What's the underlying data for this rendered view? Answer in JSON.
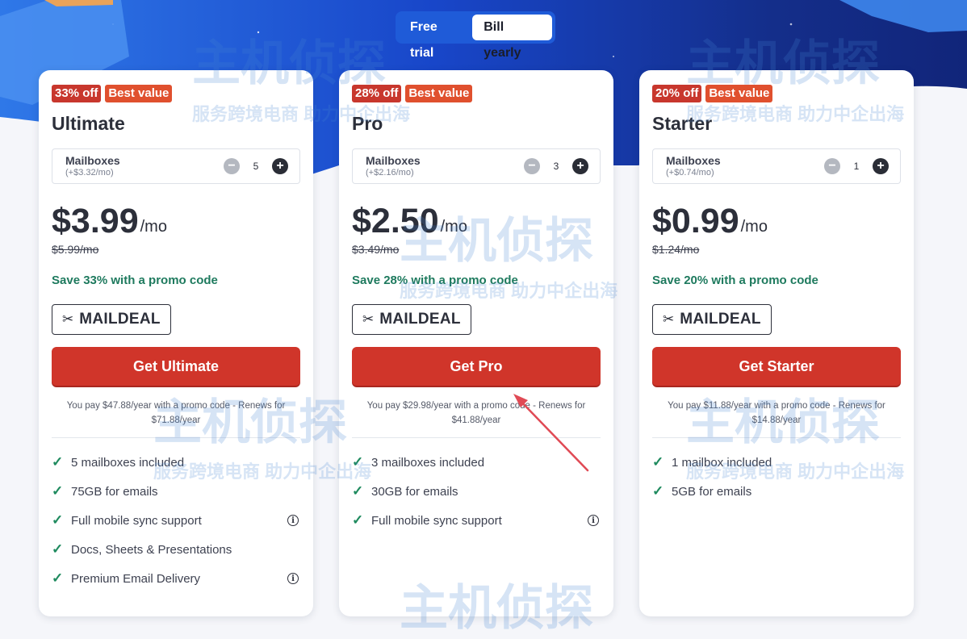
{
  "billing_toggle": {
    "free_trial": "Free trial",
    "bill_yearly": "Bill yearly",
    "selected": "Bill yearly"
  },
  "icons": {
    "scissors": "scissors-icon",
    "check": "check-icon",
    "info": "info-icon",
    "minus": "minus-icon",
    "plus": "plus-icon"
  },
  "colors": {
    "cta": "#d0352a",
    "save_text": "#1e7a5e",
    "check": "#1e8a5e",
    "hero_blue": "#1f5bd8",
    "off_badge": "#c8372d",
    "best_badge": "#e0502e"
  },
  "plans": [
    {
      "discount_badge": "33% off",
      "best_badge": "Best value",
      "name": "Ultimate",
      "mailboxes_label": "Mailboxes",
      "mailbox_price": "(+$3.32/mo)",
      "mailbox_count": "5",
      "price": "$3.99",
      "per": "/mo",
      "original_price": "$5.99/mo",
      "save_text": "Save 33% with a promo code",
      "promo_code": "MAILDEAL",
      "cta": "Get Ultimate",
      "note": "You pay $47.88/year with a promo code - Renews for $71.88/year",
      "features": [
        {
          "text": "5 mailboxes included",
          "info": false
        },
        {
          "text": "75GB for emails",
          "info": false
        },
        {
          "text": "Full mobile sync support",
          "info": true
        },
        {
          "text": "Docs, Sheets & Presentations",
          "info": false
        },
        {
          "text": "Premium Email Delivery",
          "info": true
        }
      ]
    },
    {
      "discount_badge": "28% off",
      "best_badge": "Best value",
      "name": "Pro",
      "mailboxes_label": "Mailboxes",
      "mailbox_price": "(+$2.16/mo)",
      "mailbox_count": "3",
      "price": "$2.50",
      "per": "/mo",
      "original_price": "$3.49/mo",
      "save_text": "Save 28% with a promo code",
      "promo_code": "MAILDEAL",
      "cta": "Get Pro",
      "note": "You pay $29.98/year with a promo code - Renews for $41.88/year",
      "features": [
        {
          "text": "3 mailboxes included",
          "info": false
        },
        {
          "text": "30GB for emails",
          "info": false
        },
        {
          "text": "Full mobile sync support",
          "info": true
        }
      ]
    },
    {
      "discount_badge": "20% off",
      "best_badge": "Best value",
      "name": "Starter",
      "mailboxes_label": "Mailboxes",
      "mailbox_price": "(+$0.74/mo)",
      "mailbox_count": "1",
      "price": "$0.99",
      "per": "/mo",
      "original_price": "$1.24/mo",
      "save_text": "Save 20% with a promo code",
      "promo_code": "MAILDEAL",
      "cta": "Get Starter",
      "note": "You pay $11.88/year with a promo code - Renews for $14.88/year",
      "features": [
        {
          "text": "1 mailbox included",
          "info": false
        },
        {
          "text": "5GB for emails",
          "info": false
        }
      ]
    }
  ],
  "watermark": {
    "brand": "主机侦探",
    "tagline": "服务跨境电商 助力中企出海"
  }
}
